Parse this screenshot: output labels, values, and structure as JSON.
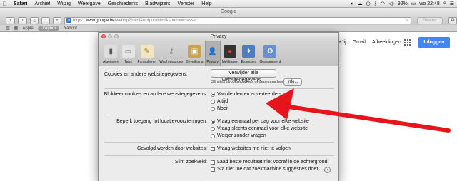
{
  "menubar": {
    "app": "Safari",
    "items": [
      "Archief",
      "Wijzig",
      "Weergave",
      "Geschiedenis",
      "Bladwijzers",
      "Venster",
      "Help"
    ],
    "battery": "92%",
    "clock": "wo 22:48"
  },
  "browser": {
    "window_title": "Google",
    "url_prefix": "https",
    "url_host": "www.google.be",
    "url_path": "/webhp?hl=nl&output=html&source=classic",
    "reader_label": "Reader",
    "bookmarks": [
      "Apple",
      "Dropbox",
      "Yahoo!"
    ]
  },
  "google": {
    "links": [
      "+Jij",
      "Gmail",
      "Afbeeldingen"
    ],
    "login_label": "Inloggen"
  },
  "prefs": {
    "title": "Privacy",
    "tabs": [
      {
        "label": "Algemeen",
        "icon": "gear-switch-icon"
      },
      {
        "label": "Tabs",
        "icon": "tabs-icon"
      },
      {
        "label": "Formulieren",
        "icon": "pencil-icon"
      },
      {
        "label": "Wachtwoorden",
        "icon": "key-icon"
      },
      {
        "label": "Beveiliging",
        "icon": "lock-icon"
      },
      {
        "label": "Privacy",
        "icon": "person-icon"
      },
      {
        "label": "Meldingen",
        "icon": "notifications-icon"
      },
      {
        "label": "Extensies",
        "icon": "puzzle-icon"
      },
      {
        "label": "Geavanceerd",
        "icon": "advanced-gear-icon"
      }
    ],
    "cookies_label": "Cookies en andere websitegegevens:",
    "remove_all_button": "Verwijder alle websitegegevens...",
    "sites_info": "39 sites hebben cookies of gegevens bewaard",
    "info_button": "Info...",
    "block_label": "Blokkeer cookies en andere websitegegevens:",
    "block_options": [
      "Van derden en adverteerders",
      "Altijd",
      "Nooit"
    ],
    "location_label": "Beperk toegang tot locatievoorzieningen:",
    "location_options": [
      "Vraag eenmaal per dag voor elke website",
      "Vraag slechts eenmaal voor elke website",
      "Weiger zonder vragen"
    ],
    "tracking_label": "Gevolgd worden door websites:",
    "tracking_option": "Vraag websites me niet te volgen",
    "smart_search_label": "Slim zoekveld:",
    "smart_search_options": [
      "Laad beste resultaat niet vooraf in de achtergrond",
      "Sta niet toe dat zoekmachine suggesties doet"
    ],
    "help_label": "?"
  },
  "colors": {
    "arrow": "#e8141c",
    "login": "#4285f4"
  }
}
